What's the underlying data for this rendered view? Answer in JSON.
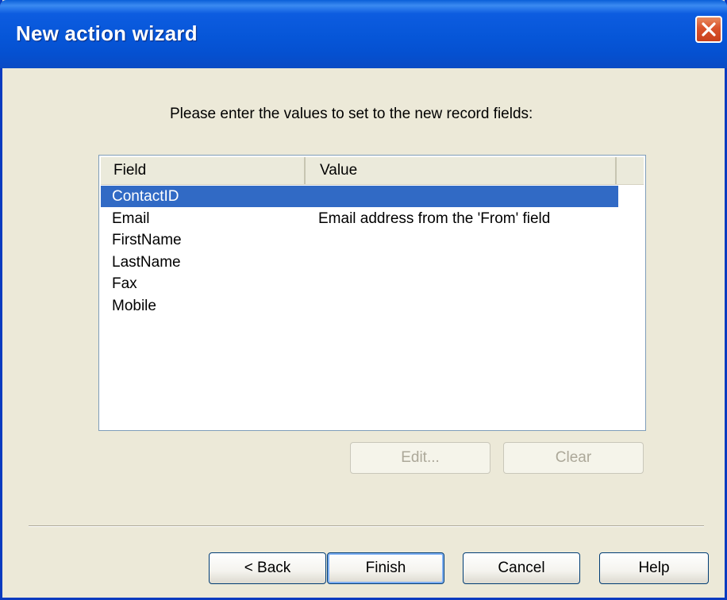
{
  "window": {
    "title": "New action wizard",
    "close_icon": "close-icon"
  },
  "prompt": "Please enter the values to set to the new record fields:",
  "list": {
    "columns": [
      "Field",
      "Value"
    ],
    "rows": [
      {
        "field": "ContactID",
        "value": "",
        "selected": true
      },
      {
        "field": "Email",
        "value": "Email address from the 'From' field",
        "selected": false
      },
      {
        "field": "FirstName",
        "value": "",
        "selected": false
      },
      {
        "field": "LastName",
        "value": "",
        "selected": false
      },
      {
        "field": "Fax",
        "value": "",
        "selected": false
      },
      {
        "field": "Mobile",
        "value": "",
        "selected": false
      }
    ]
  },
  "actions": {
    "edit_label": "Edit...",
    "clear_label": "Clear"
  },
  "footer": {
    "back_label": "< Back",
    "finish_label": "Finish",
    "cancel_label": "Cancel",
    "help_label": "Help"
  },
  "colors": {
    "titlebar": "#0656d8",
    "selection": "#316ac5",
    "dialog_bg": "#ece9d8",
    "close_button": "#d9532c"
  }
}
